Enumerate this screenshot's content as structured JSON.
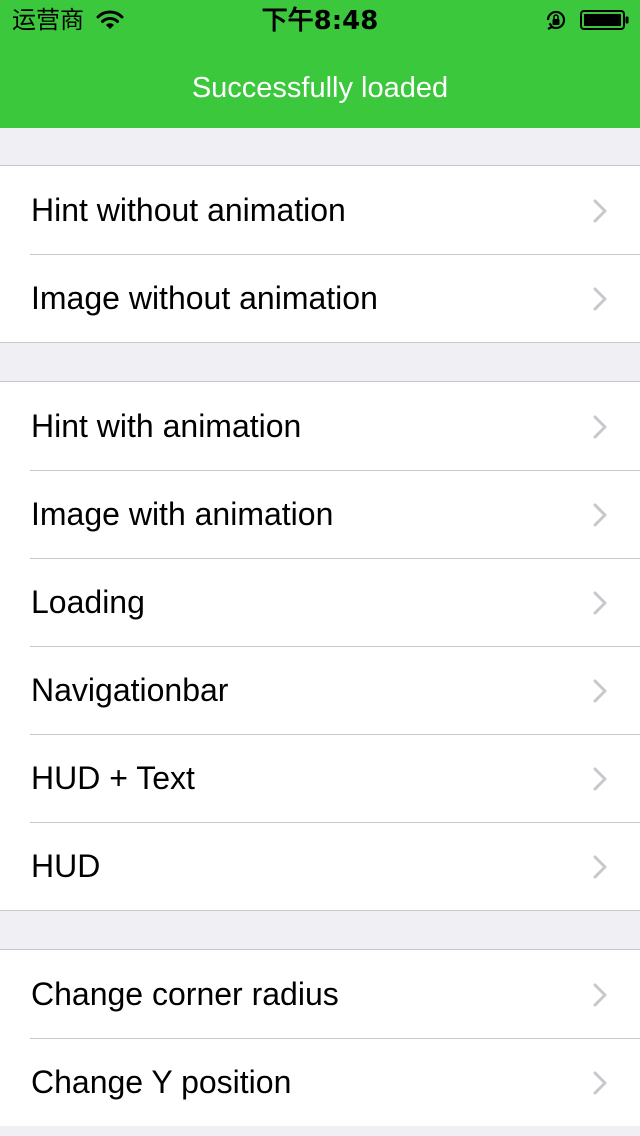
{
  "status_bar": {
    "carrier": "运营商",
    "time": "下午8:48"
  },
  "nav": {
    "title": "Successfully loaded"
  },
  "colors": {
    "nav_background": "#3cc83c",
    "page_background": "#efeff4",
    "chevron": "#c7c7cc"
  },
  "sections": [
    {
      "items": [
        {
          "label": "Hint without animation",
          "icon": "chevron-right-icon"
        },
        {
          "label": "Image without animation",
          "icon": "chevron-right-icon"
        }
      ]
    },
    {
      "items": [
        {
          "label": "Hint with animation",
          "icon": "chevron-right-icon"
        },
        {
          "label": "Image with animation",
          "icon": "chevron-right-icon"
        },
        {
          "label": "Loading",
          "icon": "chevron-right-icon"
        },
        {
          "label": "Navigationbar",
          "icon": "chevron-right-icon"
        },
        {
          "label": "HUD + Text",
          "icon": "chevron-right-icon"
        },
        {
          "label": "HUD",
          "icon": "chevron-right-icon"
        }
      ]
    },
    {
      "items": [
        {
          "label": "Change corner radius",
          "icon": "chevron-right-icon"
        },
        {
          "label": "Change Y position",
          "icon": "chevron-right-icon"
        }
      ]
    }
  ]
}
